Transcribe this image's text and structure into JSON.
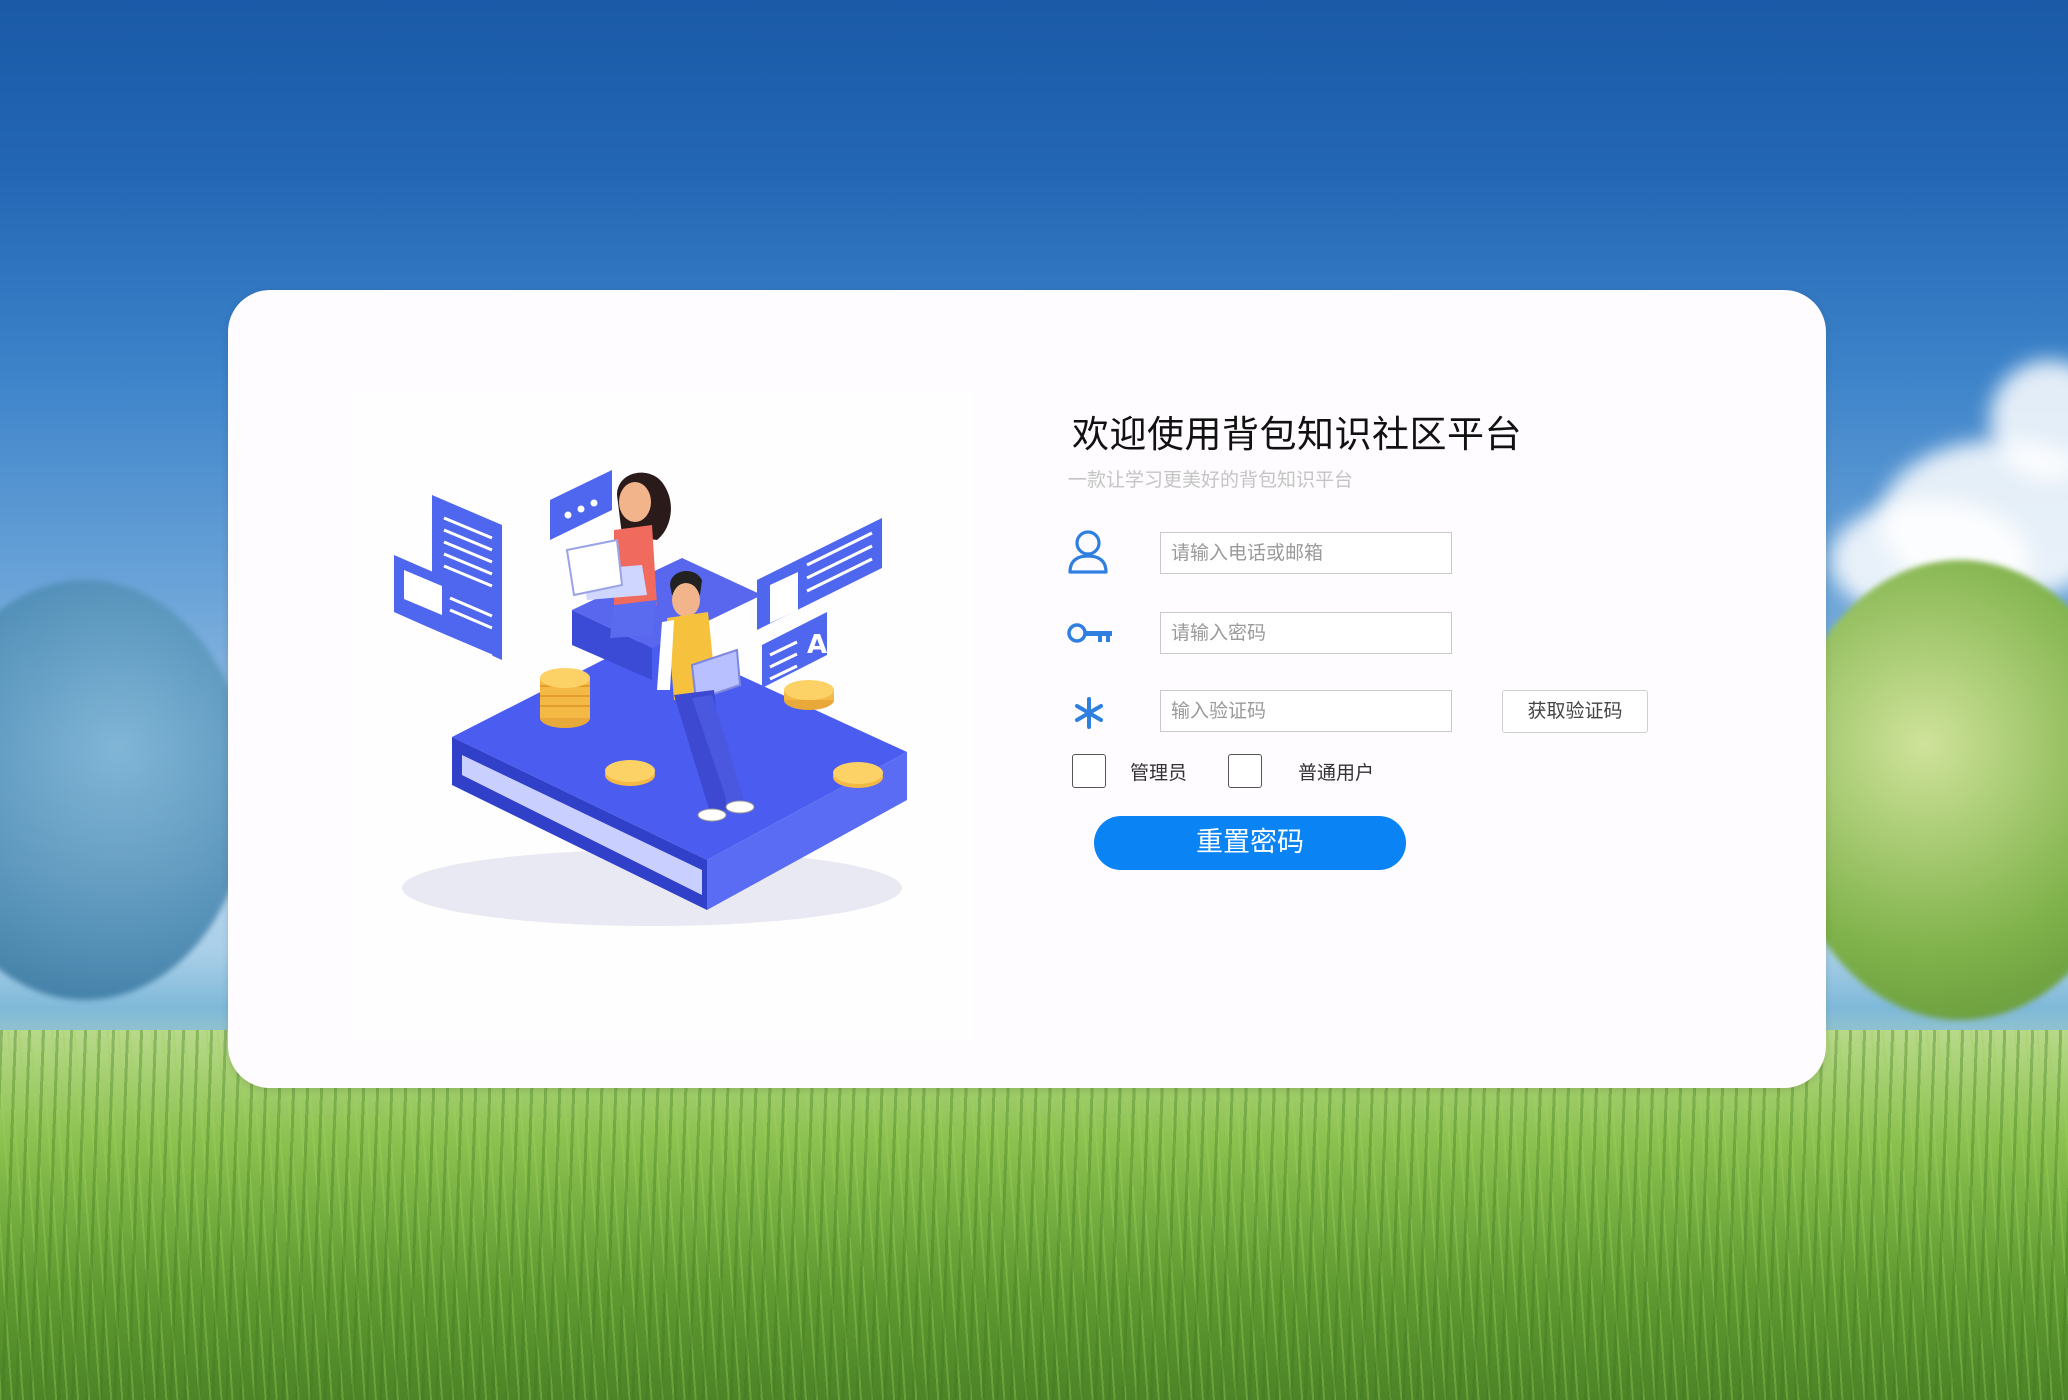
{
  "header": {
    "title": "欢迎使用背包知识社区平台",
    "subtitle": "一款让学习更美好的背包知识平台"
  },
  "form": {
    "account_placeholder": "请输入电话或邮箱",
    "password_placeholder": "请输入密码",
    "code_placeholder": "输入验证码",
    "get_code_label": "获取验证码",
    "role_admin_label": "管理员",
    "role_user_label": "普通用户",
    "submit_label": "重置密码"
  },
  "icons": {
    "account": "user-icon",
    "password": "key-icon",
    "code": "asterisk-icon"
  },
  "colors": {
    "accent": "#0a84f5",
    "icon": "#2f7fe0"
  }
}
